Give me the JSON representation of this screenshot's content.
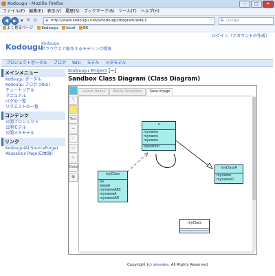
{
  "browser": {
    "window_title": "Kodougu - Mozilla Firefox",
    "menu": [
      "ファイル(F)",
      "編集(E)",
      "表示(V)",
      "履歴(S)",
      "ブックマーク(B)",
      "ツール(T)",
      "ヘルプ(H)"
    ],
    "url": "http://www.kodougu.net/p/kodougu/diagram/wiki/1",
    "search_placeholder": "Google",
    "bookmarks": [
      "よく見るページ",
      "Kodougu",
      "local",
      "BK"
    ]
  },
  "header": {
    "login": "ログイン（アカウントの作成）",
    "logo": "Kodougu",
    "logo_sub1": "Kodougu",
    "logo_sub2": "ブラウザ上で動作するモデリング環境"
  },
  "topnav": [
    "プロジェクトポータル",
    "ブログ",
    "Wiki",
    "モデル",
    "メタモデル"
  ],
  "sidebar": {
    "sections": [
      {
        "title": "メインメニュー",
        "items": [
          "Kodougu ポータル",
          "Kodougu ブログ (RSS)",
          "チュートリアル",
          "マニュアル",
          "バグの一覧",
          "リクエストの一覧"
        ]
      },
      {
        "title": "コンテンツ",
        "items": [
          "公開プロジェクト",
          "公開モデル",
          "公開メタモデル"
        ]
      },
      {
        "title": "リンク",
        "items": [
          "Kodougu(At SourceForge)",
          "Akasaka's Page(日本語)"
        ]
      }
    ]
  },
  "main": {
    "project_link": "Kodougu Project",
    "collapse": "[−]",
    "title": "Sandbox Class Diagram (Class Diagram)",
    "tabs": [
      "Layout Nodes",
      "Ready Templates",
      "Save Image"
    ],
    "active_tab": "Save Image",
    "tool_labels": [
      "Text",
      "Delete"
    ]
  },
  "diagram": {
    "classes": [
      {
        "id": "x",
        "name": "x",
        "attrs": [
          "",
          "myname",
          "myname",
          "myname"
        ],
        "ops": [
          "operation"
        ]
      },
      {
        "id": "myClass",
        "name": "myClass",
        "attrs": [
          "aa",
          "aaaaA",
          "mynameABC",
          "mynameA",
          "mynameAD"
        ],
        "ops": []
      },
      {
        "id": "myClassA",
        "name": "myClassA",
        "attrs": [
          "myname",
          "mynameD"
        ],
        "ops": []
      },
      {
        "id": "myClassB",
        "name": "myClass",
        "attrs": [],
        "ops": []
      }
    ]
  },
  "footer": {
    "prefix": "Copyright (c)",
    "link": "akasaka",
    "suffix": ". All Rights Reserved."
  },
  "colors": {
    "class_fill": "#a7ede9",
    "link": "#2a56b8",
    "nav_bg": "#dce9f7"
  }
}
